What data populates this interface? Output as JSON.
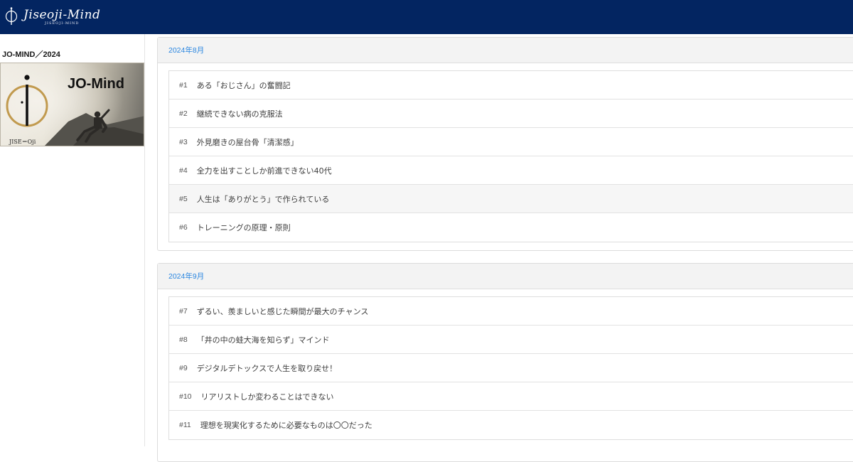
{
  "header": {
    "brand_script": "Jiseoji-Mind",
    "brand_sub": "JISEOJI-MIND"
  },
  "sidebar": {
    "title": "JO-MIND／2024",
    "banner": {
      "title": "JO-Mind",
      "mark_text": "JISE＝Oji"
    }
  },
  "sections": [
    {
      "month": "2024年8月",
      "items": [
        {
          "num": "#1",
          "title": "ある「おじさん」の奮闘記"
        },
        {
          "num": "#2",
          "title": "継続できない病の克服法"
        },
        {
          "num": "#3",
          "title": "外見磨きの屋台骨「清潔感」"
        },
        {
          "num": "#4",
          "title": "全力を出すことしか前進できない40代"
        },
        {
          "num": "#5",
          "title": "人生は「ありがとう」で作られている"
        },
        {
          "num": "#6",
          "title": "トレーニングの原理・原則"
        }
      ]
    },
    {
      "month": "2024年9月",
      "items": [
        {
          "num": "#7",
          "title": "ずるい、羨ましいと感じた瞬間が最大のチャンス"
        },
        {
          "num": "#8",
          "title": "「井の中の蛙大海を知らず」マインド"
        },
        {
          "num": "#9",
          "title": "デジタルデトックスで人生を取り戻せ！"
        },
        {
          "num": "#10",
          "title": "リアリストしか変わることはできない"
        },
        {
          "num": "#11",
          "title": "理想を現実化するために必要なものは〇〇だった"
        }
      ]
    }
  ],
  "colors": {
    "header_bg": "#032561",
    "link": "#2a86e0",
    "card_head_bg": "#f3f3f3"
  }
}
